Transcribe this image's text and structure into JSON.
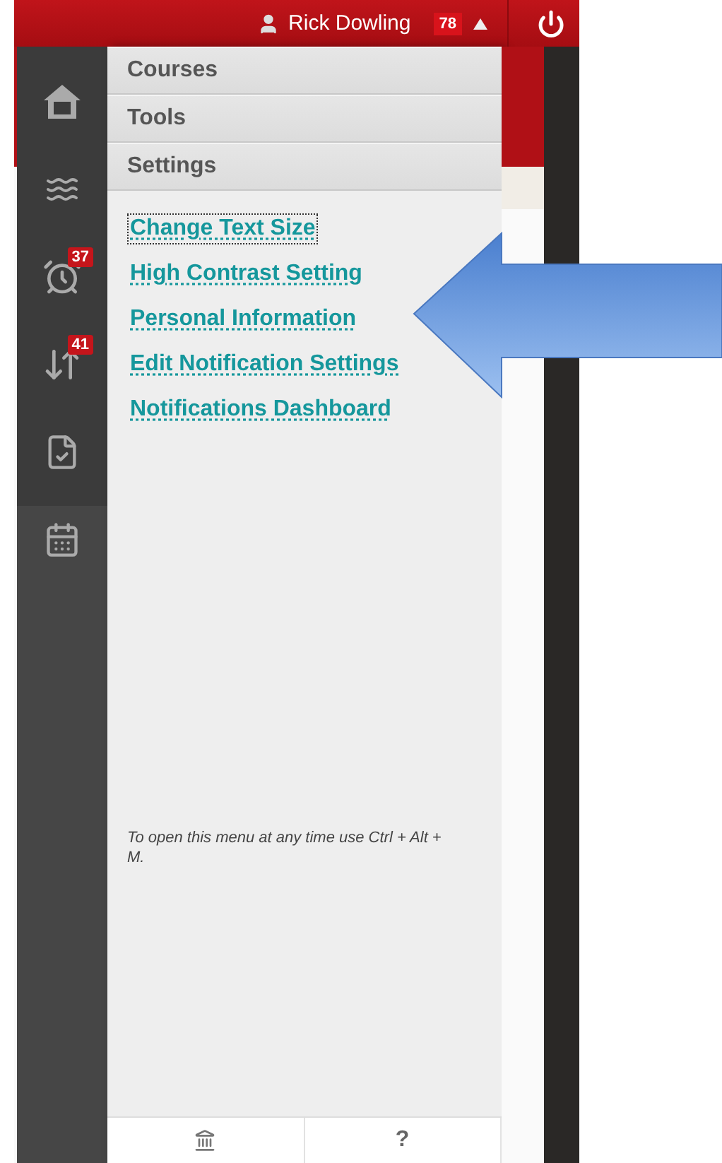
{
  "header": {
    "user_name": "Rick Dowling",
    "notification_count": "78"
  },
  "sidebar": {
    "items": [
      {
        "kind": "home"
      },
      {
        "kind": "stream"
      },
      {
        "kind": "due",
        "badge": "37"
      },
      {
        "kind": "updates",
        "badge": "41"
      },
      {
        "kind": "grades"
      },
      {
        "kind": "calendar"
      }
    ]
  },
  "menu": {
    "sections": [
      {
        "label": "Courses"
      },
      {
        "label": "Tools"
      },
      {
        "label": "Settings"
      }
    ],
    "links": [
      {
        "label": "Change Text Size",
        "focused": true
      },
      {
        "label": "High Contrast Setting",
        "focused": false
      },
      {
        "label": "Personal Information",
        "focused": false
      },
      {
        "label": "Edit Notification Settings",
        "focused": false
      },
      {
        "label": "Notifications Dashboard",
        "focused": false
      }
    ],
    "hint": "To open this menu at any time use Ctrl + Alt + M.",
    "footer": {
      "help": "?"
    }
  }
}
